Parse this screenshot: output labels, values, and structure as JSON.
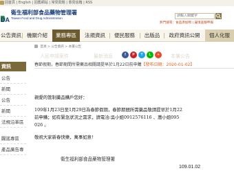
{
  "top_links": {
    "items": [
      "回首頁",
      "English",
      "ﾞ",
      "回舊網站",
      "常見問題",
      "意見信箱",
      "RSS"
    ],
    "text": "回首頁 | English | 回舊網站 | 常見問題 | 意見信箱 | RSS"
  },
  "header": {
    "logo_abbr": "DA",
    "org_name_cn": "衛生福利部食品藥物管理署",
    "org_name_en": "Taiwan Food and Drug Administration",
    "search_placeholder": "請輸入關鍵字",
    "hotkeys_label": "熱門搜尋：食品添加物 | 邊境查驗申報"
  },
  "nav": {
    "items": [
      {
        "label": "公告資訊"
      },
      {
        "label": "機關介紹"
      },
      {
        "label": "業務專區"
      },
      {
        "label": "法規資訊"
      },
      {
        "label": "便民服務"
      },
      {
        "label": "出版品"
      },
      {
        "label": "政府資訊公開"
      },
      {
        "label": "個人化服"
      }
    ]
  },
  "sidebar": {
    "title": "資訊",
    "items": [
      "公告",
      "新聞",
      "公告",
      "新聞",
      "法規沿革區",
      "闢謠專區",
      "產品廣告專"
    ]
  },
  "breadcrumb": {
    "items": [
      "首頁",
      "公告資訊",
      "本署公告"
    ]
  },
  "watermark": {
    "items": [
      "人民申請案件",
      "最新消息",
      "本署公告"
    ]
  },
  "share": {
    "items": [
      {
        "label": "f",
        "color": "#3b5998"
      },
      {
        "label": "P",
        "color": "#cb2027"
      },
      {
        "label": "T",
        "color": "#1da1f2"
      },
      {
        "label": "L",
        "color": "#00b900"
      },
      {
        "label": "+",
        "color": "#e94c2b"
      }
    ]
  },
  "article": {
    "title": "春節假期，春節期間所需藥品相關請提早於1月22日前申購",
    "date_label": "【發布日期：2020-01-02】",
    "lines": [
      "親愛的管制藥品購戶您好：",
      "109年1月23日至1月29日為春節假期，春節期間所需藥品敬請提早於1月22",
      "前申購；如有緊急狀況之需求，請電洽:吳小姐0912576116 、蕭小姐095",
      "026 。",
      "敬祝大家新春快樂，萬事如意！"
    ],
    "signature": "衛生福利部食品藥物管理署",
    "doc_date": "109.01.02"
  }
}
